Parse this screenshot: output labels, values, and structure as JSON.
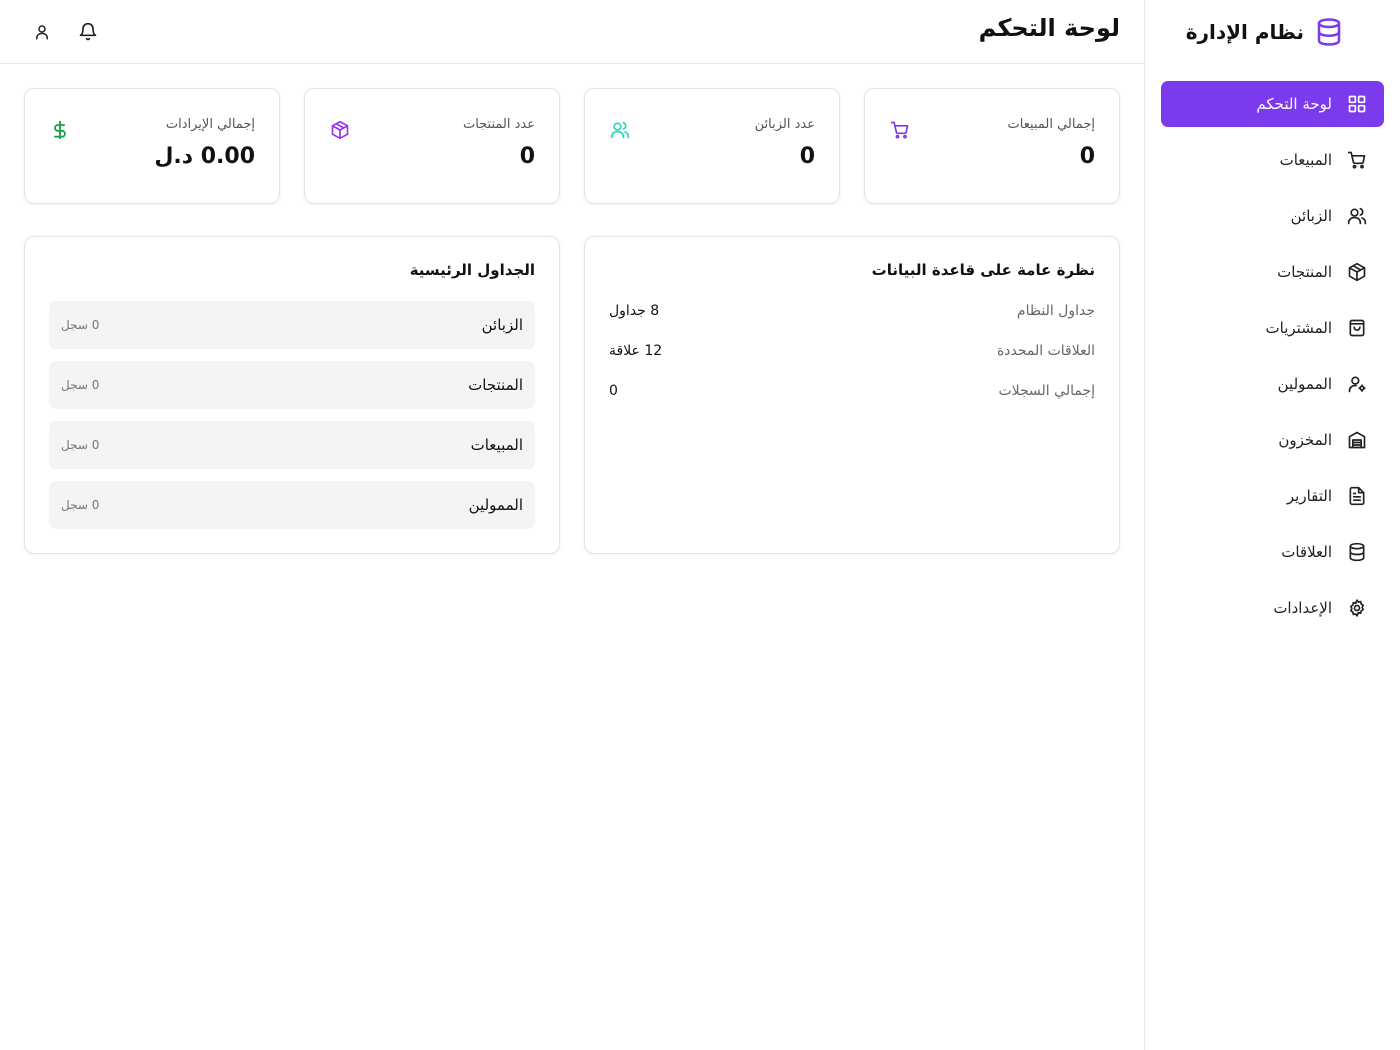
{
  "app": {
    "brand": "نظام الإدارة",
    "brand_color": "#7c3aed"
  },
  "header": {
    "title": "لوحة التحكم",
    "actions": [
      {
        "icon": "bell-icon"
      },
      {
        "icon": "user-icon"
      }
    ]
  },
  "sidebar": {
    "items": [
      {
        "label": "لوحة التحكم",
        "icon": "grid-icon",
        "active": true
      },
      {
        "label": "المبيعات",
        "icon": "cart-icon"
      },
      {
        "label": "الزبائن",
        "icon": "users-icon"
      },
      {
        "label": "المنتجات",
        "icon": "box-icon"
      },
      {
        "label": "المشتريات",
        "icon": "shopping-bag-icon"
      },
      {
        "label": "الممولين",
        "icon": "user-cog-icon"
      },
      {
        "label": "المخزون",
        "icon": "warehouse-icon"
      },
      {
        "label": "التقارير",
        "icon": "file-text-icon"
      },
      {
        "label": "العلاقات",
        "icon": "database-icon"
      },
      {
        "label": "الإعدادات",
        "icon": "gear-icon"
      }
    ]
  },
  "stats": [
    {
      "label": "إجمالي المبيعات",
      "value": "0",
      "icon": "cart-icon",
      "color": "#7c3aed"
    },
    {
      "label": "عدد الزبائن",
      "value": "0",
      "icon": "users-icon",
      "color": "#2dd4bf"
    },
    {
      "label": "عدد المنتجات",
      "value": "0",
      "icon": "box-icon",
      "color": "#9333ea"
    },
    {
      "label": "إجمالي الإيرادات",
      "value": "0.00 د.ل",
      "icon": "dollar-icon",
      "color": "#16a34a"
    }
  ],
  "overview": {
    "title": "نظرة عامة على قاعدة البيانات",
    "rows": [
      {
        "label": "جداول النظام",
        "value": "8 جداول"
      },
      {
        "label": "العلاقات المحددة",
        "value": "12 علاقة"
      },
      {
        "label": "إجمالي السجلات",
        "value": "0"
      }
    ]
  },
  "main_tables": {
    "title": "الجداول الرئيسية",
    "rows": [
      {
        "name": "الزبائن",
        "count": "0 سجل"
      },
      {
        "name": "المنتجات",
        "count": "0 سجل"
      },
      {
        "name": "المبيعات",
        "count": "0 سجل"
      },
      {
        "name": "الممولين",
        "count": "0 سجل"
      }
    ]
  }
}
